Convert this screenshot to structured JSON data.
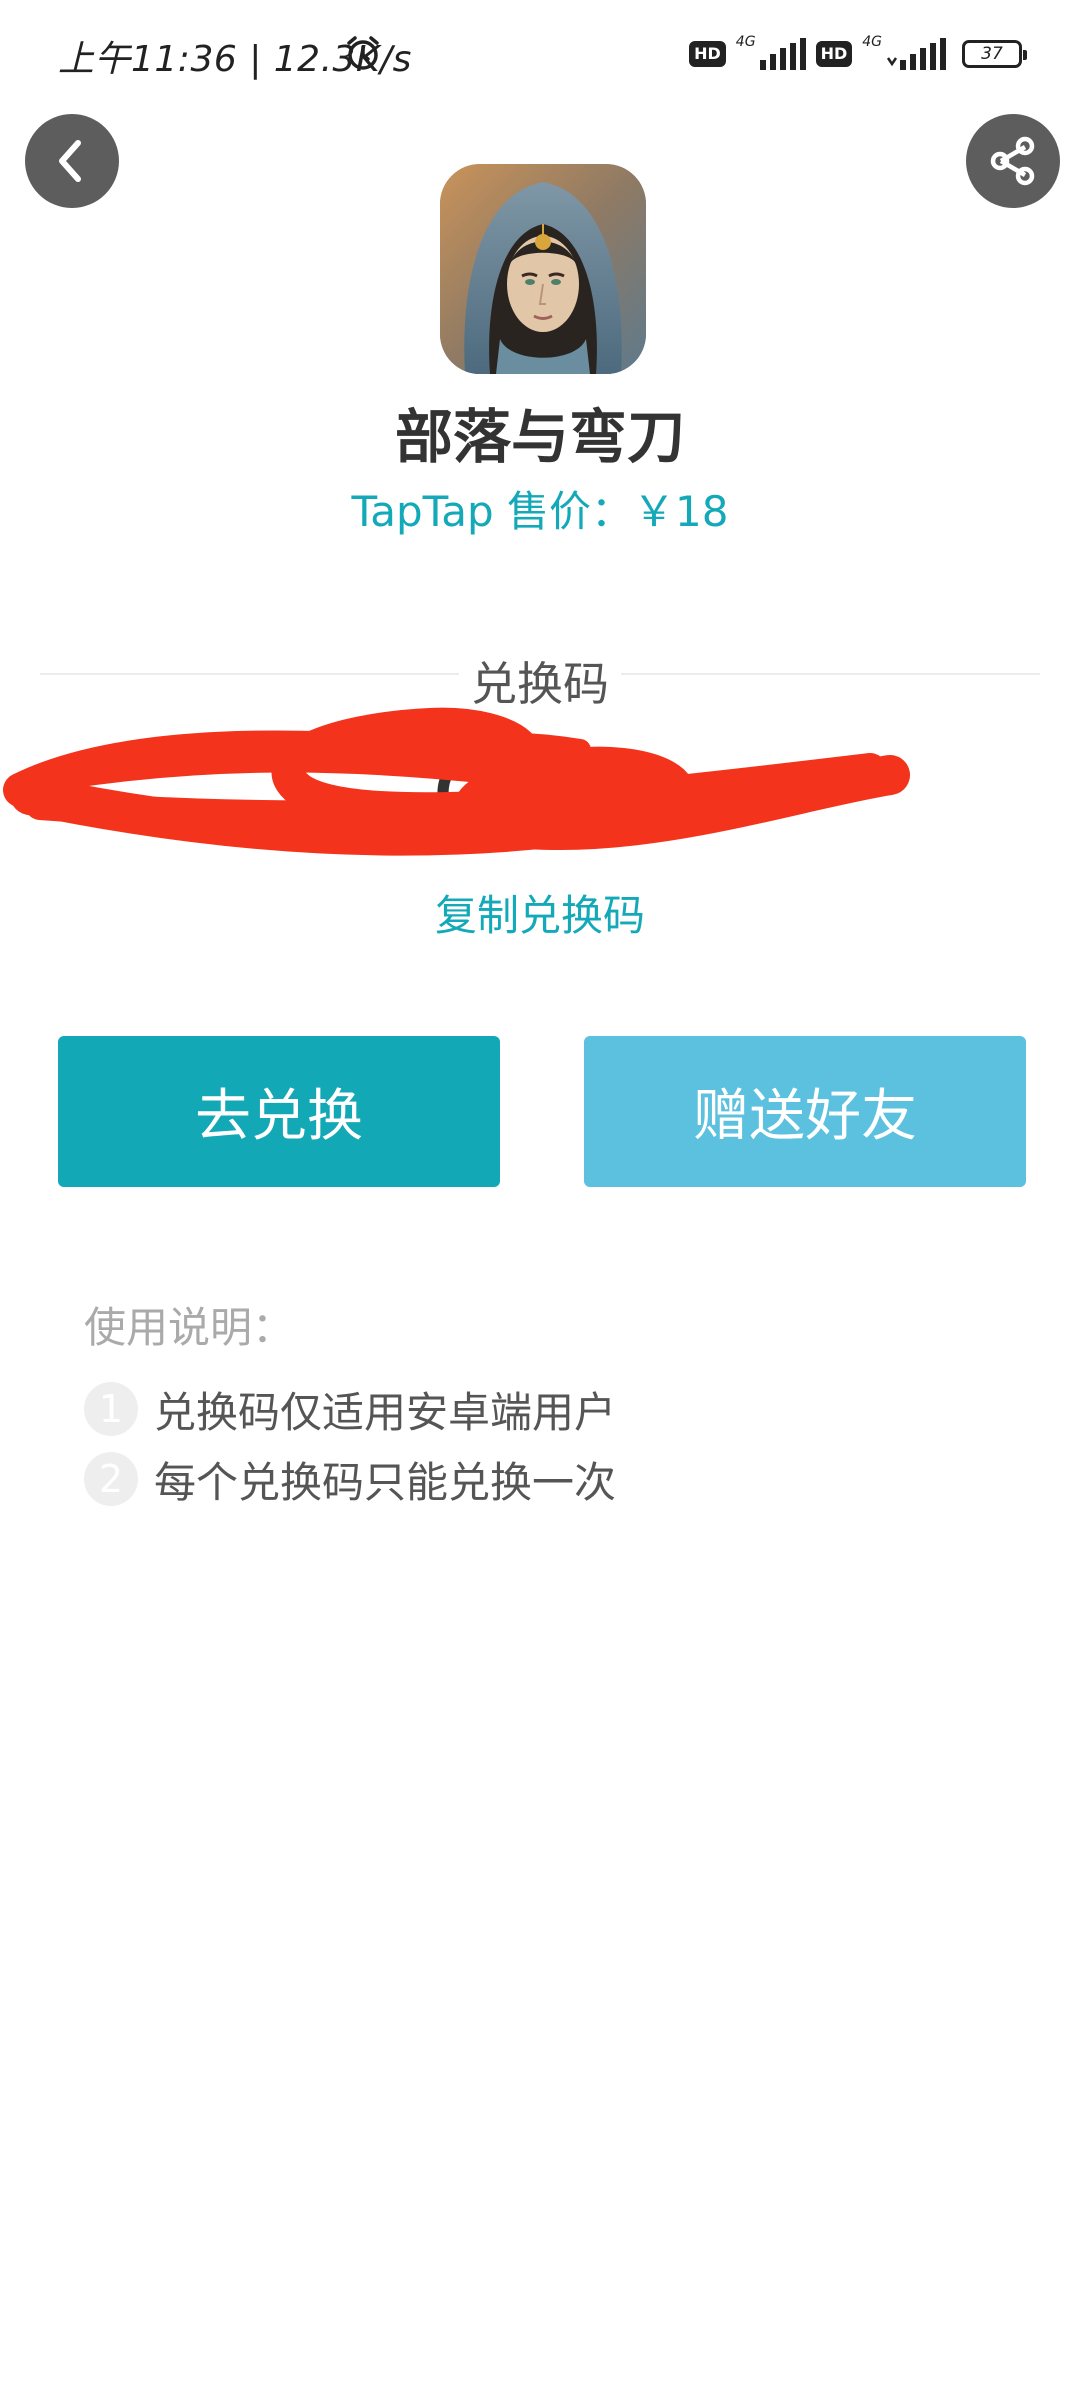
{
  "status_bar": {
    "time_speed": "上午11:36 | 12.3K/s",
    "network_tag_1": "4G",
    "network_tag_2": "4G",
    "hd_label": "HD",
    "battery_level": "37",
    "icons": [
      "alarm-icon",
      "hd-icon",
      "signal-icon",
      "battery-icon"
    ]
  },
  "header": {
    "back_icon": "back-arrow-icon",
    "share_icon": "share-icon"
  },
  "app": {
    "name": "部落与弯刀",
    "price": "TapTap 售价：￥18"
  },
  "code_section": {
    "label": "兑换码",
    "code_visible_part": "                  d2c",
    "copy_label": "复制兑换码",
    "redaction_color": "#f4331c"
  },
  "actions": {
    "redeem_label": "去兑换",
    "gift_label": "赠送好友"
  },
  "instructions": {
    "title": "使用说明：",
    "items": [
      {
        "num": "1",
        "text": "兑换码仅适用安卓端用户"
      },
      {
        "num": "2",
        "text": "每个兑换码只能兑换一次"
      }
    ]
  },
  "colors": {
    "accent": "#14a9b8",
    "redeem_button": "#12a8b6",
    "gift_button": "#5bc1de",
    "circle_button": "#5d5d5d"
  }
}
